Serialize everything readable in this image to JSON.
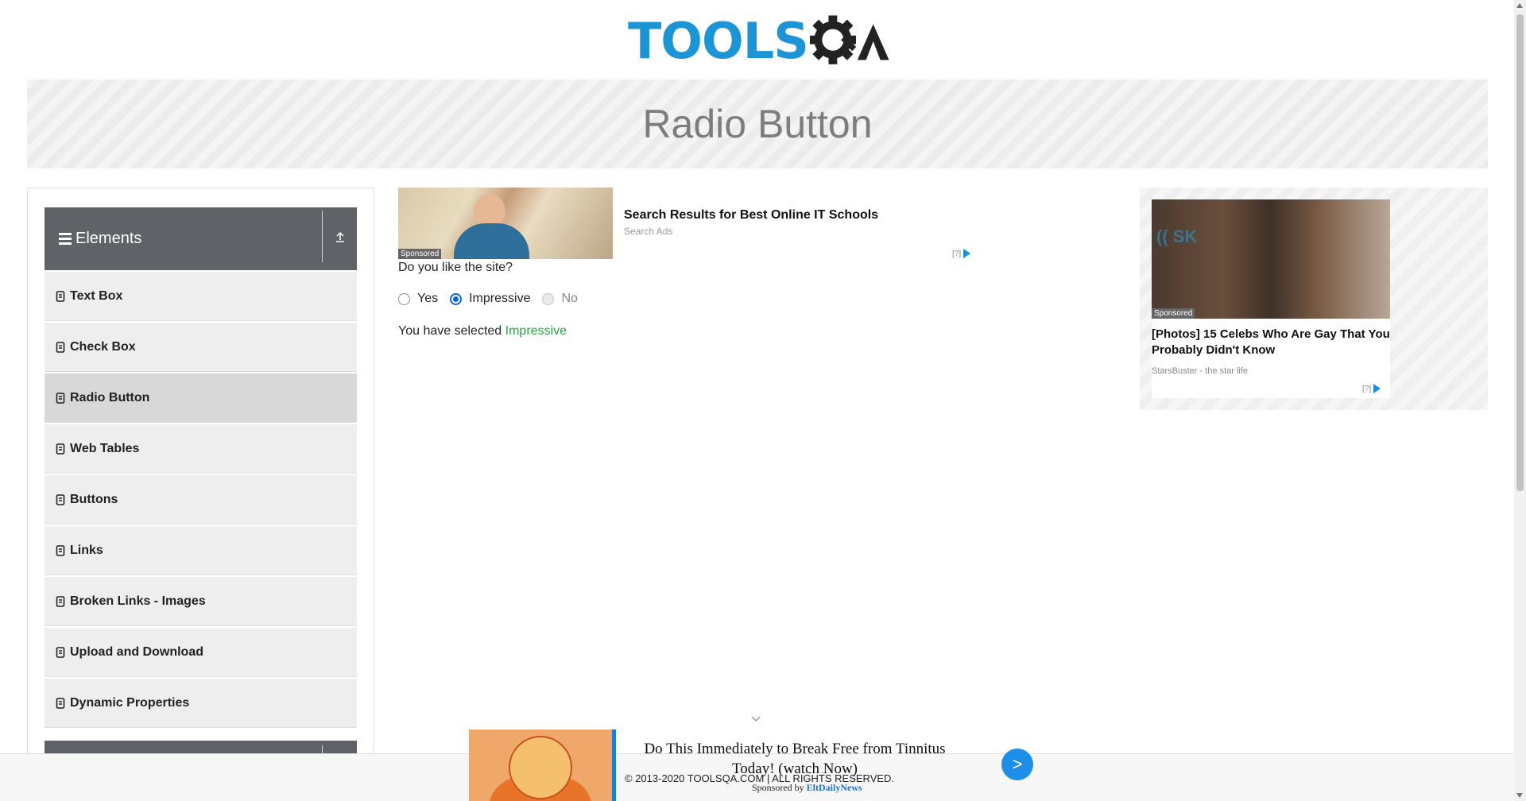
{
  "header": {
    "logo_text": "TOOLS",
    "logo_tail": "QA",
    "page_title": "Radio Button"
  },
  "sidebar": {
    "group_label": "Elements",
    "items": [
      {
        "label": "Text Box"
      },
      {
        "label": "Check Box"
      },
      {
        "label": "Radio Button",
        "active": true
      },
      {
        "label": "Web Tables"
      },
      {
        "label": "Buttons"
      },
      {
        "label": "Links"
      },
      {
        "label": "Broken Links - Images"
      },
      {
        "label": "Upload and Download"
      },
      {
        "label": "Dynamic Properties"
      }
    ]
  },
  "main": {
    "question": "Do you like the site?",
    "options": [
      {
        "label": "Yes",
        "checked": false,
        "disabled": false
      },
      {
        "label": "Impressive",
        "checked": true,
        "disabled": false
      },
      {
        "label": "No",
        "checked": false,
        "disabled": true
      }
    ],
    "result_prefix": "You have selected",
    "result_value": "Impressive"
  },
  "ads": {
    "top": {
      "sponsored": "Sponsored",
      "title": "Search Results for Best Online IT Schools",
      "source": "Search Ads",
      "choice": "[?]"
    },
    "right": {
      "image_text": "(( SK",
      "sponsored": "Sponsored",
      "title": "[Photos] 15 Celebs Who Are Gay That You Probably Didn't Know",
      "source": "StarsBuster - the star life",
      "choice": "[?]"
    },
    "bottom": {
      "headline": "Do This Immediately to Break Free from Tinnitus Today! (watch Now)",
      "sponsored_by": "Sponsored by",
      "brand": "EltDailyNews",
      "go": ">"
    }
  },
  "footer": {
    "copyright": "© 2013-2020 TOOLSQA.COM | ALL RIGHTS RESERVED."
  },
  "colors": {
    "accent": "#1b95d6",
    "group_header": "#5f6367",
    "selected_text": "#28a745",
    "radio_checked": "#0a66d6"
  }
}
